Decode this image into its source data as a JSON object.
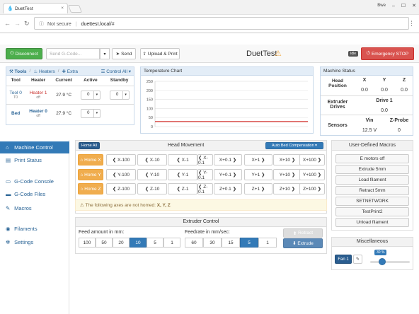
{
  "browser": {
    "tab_title": "DuetTest",
    "user_name": "Bwe",
    "url_security": "Not secure",
    "url_host": "duettest.local",
    "url_path": "/#"
  },
  "topbar": {
    "disconnect_label": "Disconnect",
    "gcode_placeholder": "Send G-Code...",
    "send_label": "Send",
    "upload_label": "Upload & Print",
    "title": "DuetTest",
    "badge": "Idle",
    "estop_label": "Emergency STOP"
  },
  "tools_panel": {
    "tabs": [
      "Tools",
      "Heaters",
      "Extra"
    ],
    "control_all": "Control All",
    "headers": [
      "Tool",
      "Heater",
      "Current",
      "Active",
      "Standby"
    ],
    "rows": [
      {
        "tool": "Tool 0",
        "tool_sub": "T0",
        "heater": "Heater 1",
        "heater_state": "off",
        "current": "27.9 °C",
        "active": "0",
        "standby": "0"
      },
      {
        "tool": "Bed",
        "tool_sub": "",
        "heater": "Heater 0",
        "heater_state": "off",
        "current": "27.9 °C",
        "active": "0",
        "standby": ""
      }
    ]
  },
  "temp_chart": {
    "title": "Temperature Chart",
    "y_ticks": [
      "250",
      "200",
      "150",
      "100",
      "50",
      "0"
    ]
  },
  "chart_data": {
    "type": "line",
    "title": "Temperature Chart",
    "ylim": [
      0,
      250
    ],
    "y_ticks": [
      0,
      50,
      100,
      150,
      200,
      250
    ],
    "grid": true,
    "series": [
      {
        "values": [
          27.9,
          27.9
        ],
        "color": "#d9534f"
      }
    ]
  },
  "machine_status": {
    "title": "Machine Status",
    "head_position_label": "Head Position",
    "axes": [
      "X",
      "Y",
      "Z"
    ],
    "positions": [
      "0.0",
      "0.0",
      "0.0"
    ],
    "extruder_label": "Extruder Drives",
    "drive_label": "Drive 1",
    "drive_value": "0.0",
    "sensors_label": "Sensors",
    "vin_label": "Vin",
    "vin_value": "12.5 V",
    "zprobe_label": "Z-Probe",
    "zprobe_value": "0"
  },
  "sidebar": {
    "items": [
      {
        "label": "Machine Control",
        "icon": "home-icon",
        "glyph": "⌂"
      },
      {
        "label": "Print Status",
        "icon": "file-icon",
        "glyph": "▤"
      },
      {
        "label": "G-Code Console",
        "icon": "console-icon",
        "glyph": "▭"
      },
      {
        "label": "G-Code Files",
        "icon": "hdd-icon",
        "glyph": "▬"
      },
      {
        "label": "Macros",
        "icon": "macro-icon",
        "glyph": "✎"
      },
      {
        "label": "Filaments",
        "icon": "filament-icon",
        "glyph": "◉"
      },
      {
        "label": "Settings",
        "icon": "gear-icon",
        "glyph": "✻"
      }
    ]
  },
  "head_movement": {
    "home_all": "Home All",
    "title": "Head Movement",
    "auto_bed": "Auto Bed Compensation",
    "home_labels": [
      "Home X",
      "Home Y",
      "Home Z"
    ],
    "neg": [
      [
        "X-100",
        "X-10",
        "X-1",
        "X-0.1"
      ],
      [
        "Y-100",
        "Y-10",
        "Y-1",
        "Y-0.1"
      ],
      [
        "Z-100",
        "Z-10",
        "Z-1",
        "Z-0.1"
      ]
    ],
    "pos": [
      [
        "X+0.1",
        "X+1",
        "X+10",
        "X+100"
      ],
      [
        "Y+0.1",
        "Y+1",
        "Y+10",
        "Y+100"
      ],
      [
        "Z+0.1",
        "Z+1",
        "Z+10",
        "Z+100"
      ]
    ],
    "warning_prefix": "The following axes are not homed: ",
    "warning_axes": "X, Y, Z"
  },
  "extruder": {
    "title": "Extruder Control",
    "feed_label": "Feed amount in mm:",
    "feed_values": [
      "100",
      "50",
      "20",
      "10",
      "5",
      "1"
    ],
    "feed_selected": 3,
    "rate_label": "Feedrate in mm/sec:",
    "rate_values": [
      "60",
      "30",
      "15",
      "5",
      "1"
    ],
    "rate_selected": 3,
    "retract": "Retract",
    "extrude": "Extrude"
  },
  "macros": {
    "title": "User-Defined Macros",
    "items": [
      "E motors off",
      "Extrude 5mm",
      "Load filament",
      "Retract 5mm",
      "SETNETWORK",
      "TestPrint2",
      "Unload filament"
    ]
  },
  "misc": {
    "title": "Miscellaneous",
    "fan_label": "Fan 1",
    "fan_value": "30 %",
    "fan_fraction": 0.3
  }
}
